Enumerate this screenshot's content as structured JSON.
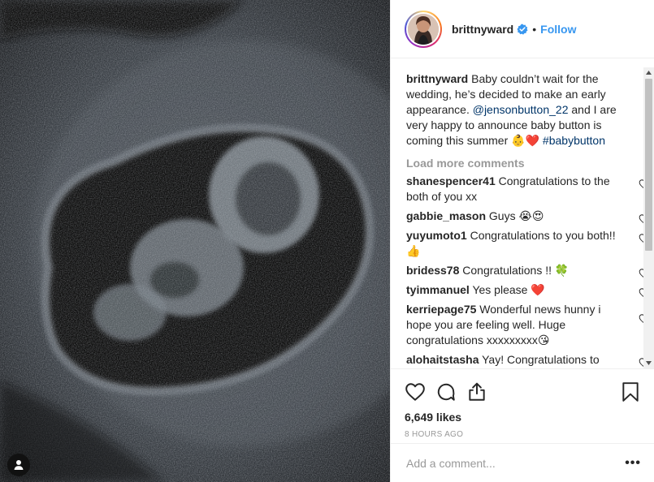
{
  "post": {
    "image_alt": "ultrasound scan",
    "user_tag_icon": "person-icon"
  },
  "header": {
    "username": "brittnyward",
    "verified_icon": "verified-badge-icon",
    "separator": "•",
    "follow_label": "Follow"
  },
  "caption": {
    "username": "brittnyward",
    "text_1": "Baby couldn’t wait for the wedding, he’s decided to make an early appearance. ",
    "mention": "@jensonbutton_22",
    "text_2": " and I are very happy to announce baby button is coming this summer ",
    "emoji": "👶❤️",
    "hashtag": "#babybutton"
  },
  "load_more_label": "Load more comments",
  "comments": [
    {
      "username": "shanespencer41",
      "text": "Congratulations to the both of you xx"
    },
    {
      "username": "gabbie_mason",
      "text": "Guys 😭😍"
    },
    {
      "username": "yuyumoto1",
      "text": "Congratulations to you both!!👍"
    },
    {
      "username": "bridess78",
      "text": "Congratulations !! 🍀"
    },
    {
      "username": "tyimmanuel",
      "text": "Yes please ❤️"
    },
    {
      "username": "kerriepage75",
      "text": "Wonderful news hunny i hope you are feeling well. Huge congratulations xxxxxxxxx😘"
    },
    {
      "username": "alohaitstasha",
      "text": "Yay! Congratulations to you both! 💙"
    }
  ],
  "actions": {
    "like_icon": "heart-icon",
    "comment_icon": "comment-icon",
    "share_icon": "share-icon",
    "save_icon": "bookmark-icon"
  },
  "likes": "6,649 likes",
  "timestamp": "8 HOURS AGO",
  "add_comment": {
    "placeholder": "Add a comment...",
    "more_label": "•••"
  },
  "colors": {
    "link_blue": "#3897f0",
    "mention_blue": "#003569",
    "muted": "#999999",
    "heart_red": "#ed4956"
  }
}
